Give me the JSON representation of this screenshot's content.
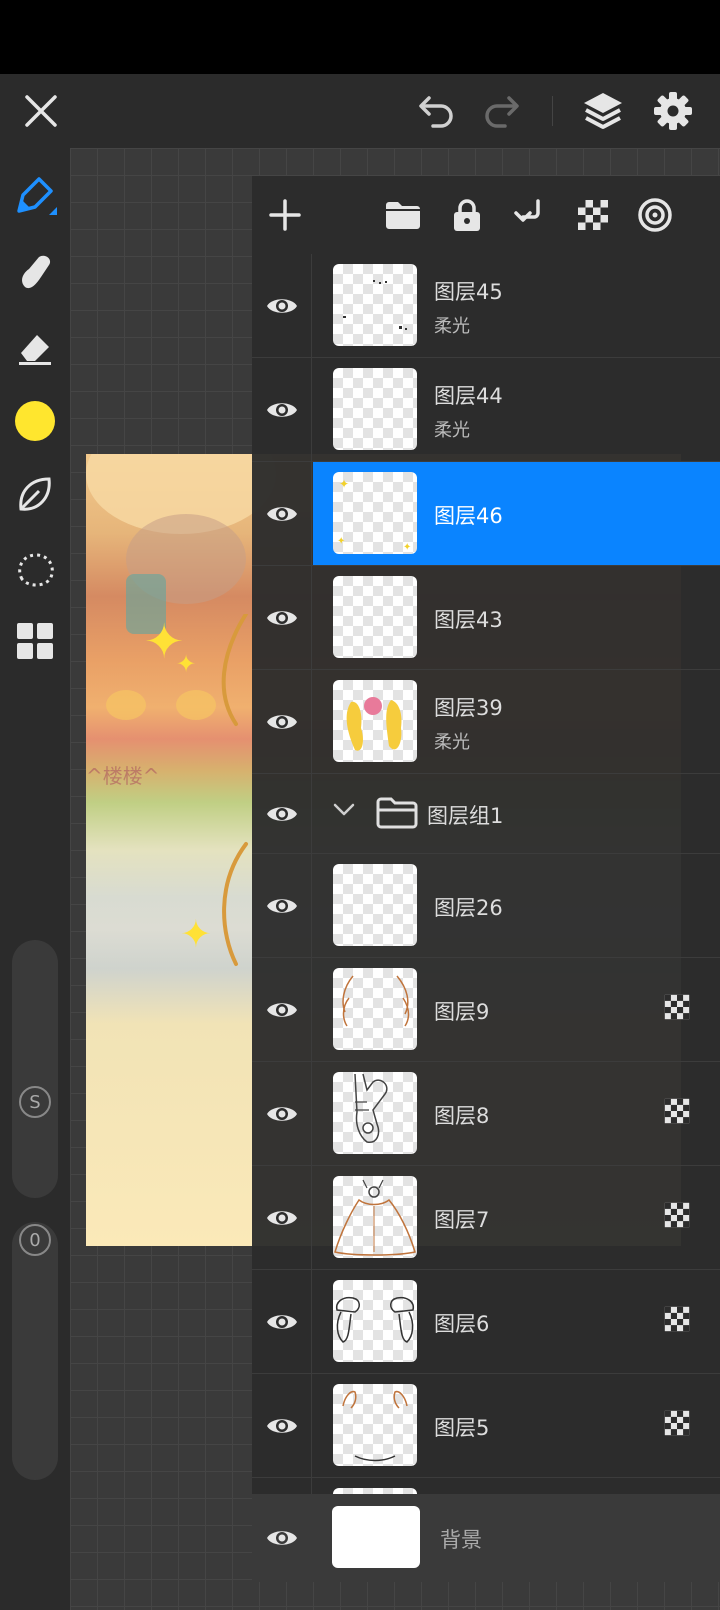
{
  "topbar": {
    "close_icon": "close-icon",
    "undo_icon": "undo-icon",
    "redo_icon": "redo-icon",
    "layers_icon": "layers-icon",
    "settings_icon": "settings-icon"
  },
  "tools": {
    "items": [
      "pen-icon",
      "smudge-icon",
      "eraser-icon",
      "color-swatch",
      "leaf-icon",
      "lasso-icon",
      "grid-icon"
    ],
    "current_color": "#ffe62e",
    "size_label": "S",
    "opacity_label": "0"
  },
  "artwork": {
    "caption": "^楼楼^"
  },
  "layer_panel": {
    "toolbar": [
      "add-layer-icon",
      "folder-icon",
      "lock-icon",
      "merge-down-icon",
      "alpha-lock-icon",
      "clip-mask-icon"
    ],
    "layers": [
      {
        "name": "图层45",
        "mode": "柔光",
        "selected": false,
        "alpha_locked": false
      },
      {
        "name": "图层44",
        "mode": "柔光",
        "selected": false,
        "alpha_locked": false
      },
      {
        "name": "图层46",
        "mode": "",
        "selected": true,
        "alpha_locked": false
      },
      {
        "name": "图层43",
        "mode": "",
        "selected": false,
        "alpha_locked": false
      },
      {
        "name": "图层39",
        "mode": "柔光",
        "selected": false,
        "alpha_locked": false
      },
      {
        "name": "图层组1",
        "mode": "",
        "selected": false,
        "is_group": true,
        "expanded": true
      },
      {
        "name": "图层26",
        "mode": "",
        "selected": false,
        "alpha_locked": false
      },
      {
        "name": "图层9",
        "mode": "",
        "selected": false,
        "alpha_locked": true
      },
      {
        "name": "图层8",
        "mode": "",
        "selected": false,
        "alpha_locked": true
      },
      {
        "name": "图层7",
        "mode": "",
        "selected": false,
        "alpha_locked": true
      },
      {
        "name": "图层6",
        "mode": "",
        "selected": false,
        "alpha_locked": true
      },
      {
        "name": "图层5",
        "mode": "",
        "selected": false,
        "alpha_locked": true
      }
    ],
    "background_label": "背景",
    "selected_color": "#0a84ff"
  }
}
